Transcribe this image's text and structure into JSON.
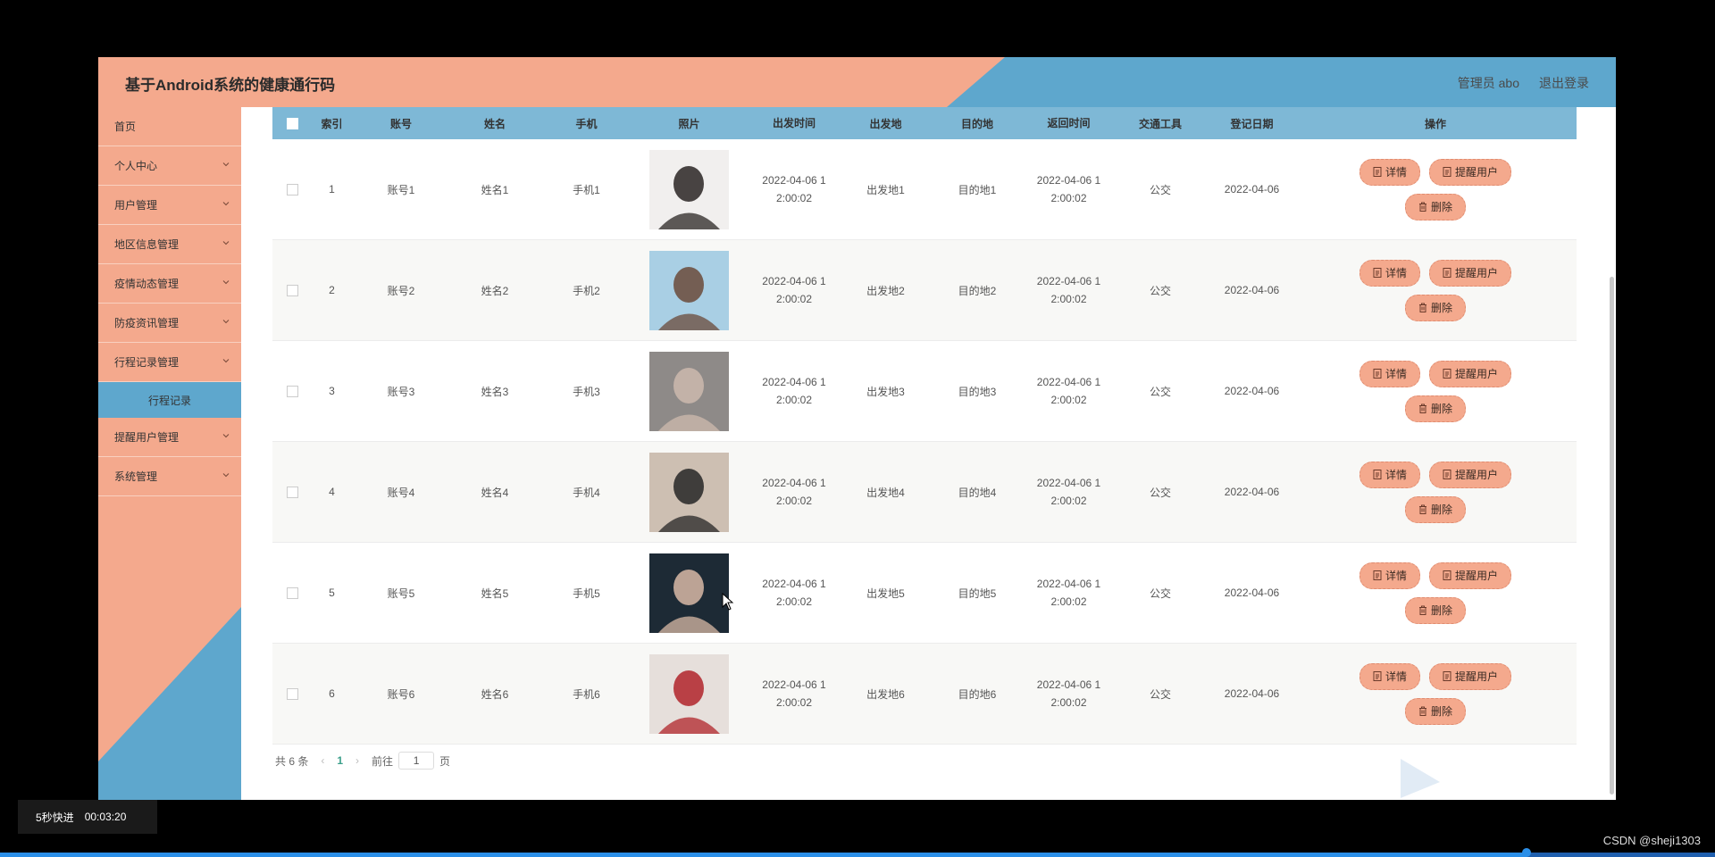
{
  "header": {
    "title": "基于Android系统的健康通行码",
    "user": "管理员 abo",
    "logout": "退出登录"
  },
  "sidebar": {
    "items": [
      {
        "label": "首页",
        "chevron": false
      },
      {
        "label": "个人中心",
        "chevron": true
      },
      {
        "label": "用户管理",
        "chevron": true
      },
      {
        "label": "地区信息管理",
        "chevron": true
      },
      {
        "label": "疫情动态管理",
        "chevron": true
      },
      {
        "label": "防疫资讯管理",
        "chevron": true
      },
      {
        "label": "行程记录管理",
        "chevron": true
      },
      {
        "label": "提醒用户管理",
        "chevron": true
      },
      {
        "label": "系统管理",
        "chevron": true
      }
    ],
    "active_sub": "行程记录"
  },
  "table": {
    "columns": [
      "索引",
      "账号",
      "姓名",
      "手机",
      "照片",
      "出发时间",
      "出发地",
      "目的地",
      "返回时间",
      "交通工具",
      "登记日期",
      "操作"
    ],
    "rows": [
      {
        "idx": "1",
        "account": "账号1",
        "name": "姓名1",
        "phone": "手机1",
        "dep_time": "2022-04-06 12:00:02",
        "dep_line1": "2022-04-06 1",
        "dep_line2": "2:00:02",
        "from": "出发地1",
        "to": "目的地1",
        "ret_line1": "2022-04-06 1",
        "ret_line2": "2:00:02",
        "transport": "公交",
        "reg_date": "2022-04-06"
      },
      {
        "idx": "2",
        "account": "账号2",
        "name": "姓名2",
        "phone": "手机2",
        "dep_time": "2022-04-06 12:00:02",
        "dep_line1": "2022-04-06 1",
        "dep_line2": "2:00:02",
        "from": "出发地2",
        "to": "目的地2",
        "ret_line1": "2022-04-06 1",
        "ret_line2": "2:00:02",
        "transport": "公交",
        "reg_date": "2022-04-06"
      },
      {
        "idx": "3",
        "account": "账号3",
        "name": "姓名3",
        "phone": "手机3",
        "dep_time": "2022-04-06 12:00:02",
        "dep_line1": "2022-04-06 1",
        "dep_line2": "2:00:02",
        "from": "出发地3",
        "to": "目的地3",
        "ret_line1": "2022-04-06 1",
        "ret_line2": "2:00:02",
        "transport": "公交",
        "reg_date": "2022-04-06"
      },
      {
        "idx": "4",
        "account": "账号4",
        "name": "姓名4",
        "phone": "手机4",
        "dep_time": "2022-04-06 12:00:02",
        "dep_line1": "2022-04-06 1",
        "dep_line2": "2:00:02",
        "from": "出发地4",
        "to": "目的地4",
        "ret_line1": "2022-04-06 1",
        "ret_line2": "2:00:02",
        "transport": "公交",
        "reg_date": "2022-04-06"
      },
      {
        "idx": "5",
        "account": "账号5",
        "name": "姓名5",
        "phone": "手机5",
        "dep_time": "2022-04-06 12:00:02",
        "dep_line1": "2022-04-06 1",
        "dep_line2": "2:00:02",
        "from": "出发地5",
        "to": "目的地5",
        "ret_line1": "2022-04-06 1",
        "ret_line2": "2:00:02",
        "transport": "公交",
        "reg_date": "2022-04-06"
      },
      {
        "idx": "6",
        "account": "账号6",
        "name": "姓名6",
        "phone": "手机6",
        "dep_time": "2022-04-06 12:00:02",
        "dep_line1": "2022-04-06 1",
        "dep_line2": "2:00:02",
        "from": "出发地6",
        "to": "目的地6",
        "ret_line1": "2022-04-06 1",
        "ret_line2": "2:00:02",
        "transport": "公交",
        "reg_date": "2022-04-06"
      }
    ],
    "actions": {
      "detail": "详情",
      "remind": "提醒用户",
      "delete": "删除"
    },
    "photo_colors": [
      [
        "#f1efee",
        "#2a2523"
      ],
      [
        "#a9cfe4",
        "#6b4a3a"
      ],
      [
        "#8e8a88",
        "#cdb9ae"
      ],
      [
        "#cdbfb2",
        "#262626"
      ],
      [
        "#1d2a35",
        "#d8b9a6"
      ],
      [
        "#e6dfdb",
        "#b0242a"
      ]
    ]
  },
  "pagination": {
    "total": "共 6 条",
    "current": "1",
    "goto_label": "前往",
    "goto_value": "1",
    "page_unit": "页"
  },
  "player": {
    "speed_label": "5秒快进",
    "time": "00:03:20",
    "progress": 0.89
  },
  "credit": "CSDN @sheji1303",
  "colors": {
    "peach": "#f4a98d",
    "blue": "#5ea7cd",
    "thead": "#7eb8d6",
    "progress": "#2b8fe8"
  }
}
